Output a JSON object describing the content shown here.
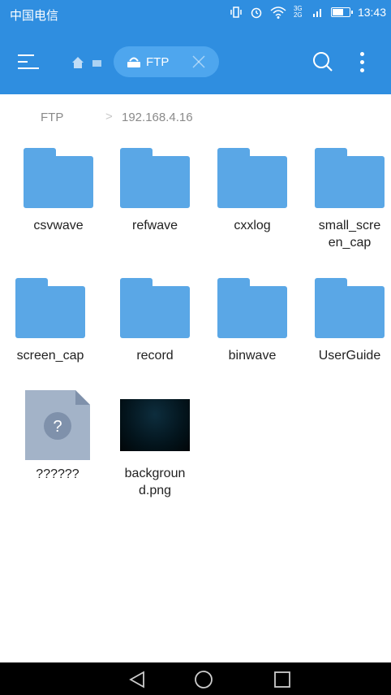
{
  "status_bar": {
    "carrier": "中国电信",
    "network": "3G 2G",
    "time": "13:43",
    "battery_percent": 70
  },
  "app_bar": {
    "tab_label": "FTP",
    "icons": [
      "menu-icon",
      "home-icon",
      "router-icon",
      "close-icon",
      "search-icon",
      "more-vert-icon"
    ]
  },
  "breadcrumb": {
    "root": "FTP",
    "separator": ">",
    "current": "192.168.4.16"
  },
  "files": [
    {
      "name": "csvwave",
      "type": "folder"
    },
    {
      "name": "refwave",
      "type": "folder"
    },
    {
      "name": "cxxlog",
      "type": "folder"
    },
    {
      "name": "small_scre\nen_cap",
      "type": "folder"
    },
    {
      "name": "screen_cap",
      "type": "folder"
    },
    {
      "name": "record",
      "type": "folder"
    },
    {
      "name": "binwave",
      "type": "folder"
    },
    {
      "name": "UserGuide",
      "type": "folder"
    },
    {
      "name": "??????",
      "type": "unknown-file",
      "glyph": "?"
    },
    {
      "name": "backgroun\nd.png",
      "type": "image"
    }
  ],
  "colors": {
    "primary": "#2f8ee0",
    "folder": "#5aa7e6",
    "tab_pill": "#4ea6ee"
  }
}
